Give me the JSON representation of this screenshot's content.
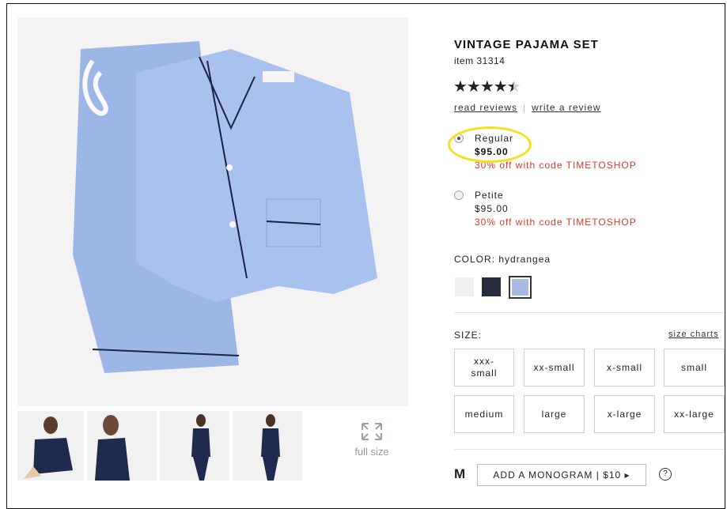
{
  "product": {
    "title": "VINTAGE PAJAMA SET",
    "item_number": "item 31314",
    "rating_stars": 4.5,
    "stars_glyph": "★★★★",
    "read_reviews": "read reviews",
    "write_review": "write a review",
    "separator": "|"
  },
  "options": [
    {
      "name": "Regular",
      "price": "$95.00",
      "promo": "30% off with code TIMETOSHOP",
      "selected": true
    },
    {
      "name": "Petite",
      "price": "$95.00",
      "promo": "30% off with code TIMETOSHOP",
      "selected": false
    }
  ],
  "color": {
    "label": "COLOR: hydrangea",
    "swatches": [
      {
        "color": "#efefef"
      },
      {
        "color": "#262b3d"
      },
      {
        "color": "#a8b9e2",
        "selected": true
      }
    ]
  },
  "size": {
    "label": "SIZE:",
    "charts_link": "size charts",
    "options": [
      "xxx-\nsmall",
      "xx-small",
      "x-small",
      "small",
      "medium",
      "large",
      "x-large",
      "xx-large"
    ]
  },
  "monogram": {
    "letter": "M",
    "button": "ADD A MONOGRAM | $10 ▸",
    "help": "?"
  },
  "gallery": {
    "full_size": "full size"
  }
}
